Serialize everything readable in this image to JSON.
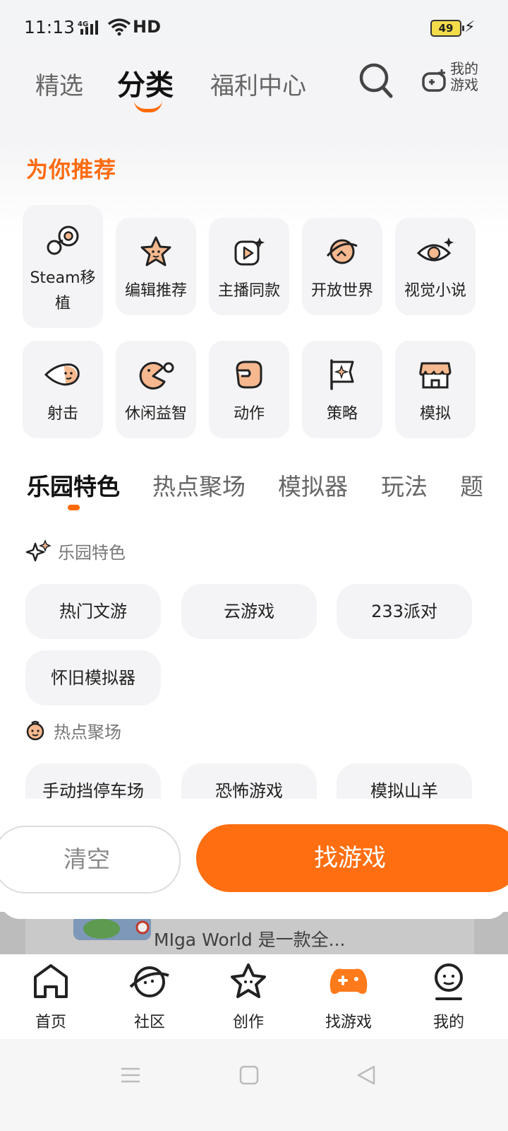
{
  "status": {
    "time": "11:13",
    "network": "4G",
    "hd": "HD",
    "battery": "49"
  },
  "top_tabs": [
    {
      "label": "精选"
    },
    {
      "label": "分类",
      "active": true
    },
    {
      "label": "福利中心"
    }
  ],
  "my_games_label": "我的游戏",
  "recommend_title": "为你推荐",
  "categories": [
    {
      "label": "Steam移植",
      "icon": "steam-icon"
    },
    {
      "label": "编辑推荐",
      "icon": "star-icon"
    },
    {
      "label": "主播同款",
      "icon": "play-icon"
    },
    {
      "label": "开放世界",
      "icon": "planet-icon"
    },
    {
      "label": "视觉小说",
      "icon": "eye-icon"
    },
    {
      "label": "射击",
      "icon": "bullet-icon"
    },
    {
      "label": "休闲益智",
      "icon": "pacman-icon"
    },
    {
      "label": "动作",
      "icon": "fist-icon"
    },
    {
      "label": "策略",
      "icon": "flag-icon"
    },
    {
      "label": "模拟",
      "icon": "shop-icon"
    }
  ],
  "sub_tabs": [
    {
      "label": "乐园特色",
      "active": true
    },
    {
      "label": "热点聚场"
    },
    {
      "label": "模拟器"
    },
    {
      "label": "玩法"
    },
    {
      "label": "题"
    }
  ],
  "groups": [
    {
      "title": "乐园特色",
      "icon": "sparkle-icon",
      "chips": [
        "热门文游",
        "云游戏",
        "233派对",
        "怀旧模拟器"
      ]
    },
    {
      "title": "热点聚场",
      "icon": "smile-icon",
      "chips": [
        "手动挡停车场",
        "恐怖游戏",
        "模拟山羊"
      ]
    }
  ],
  "behind_text": "MIga World 是一款全...",
  "buttons": {
    "clear": "清空",
    "find": "找游戏"
  },
  "bottom_nav": [
    {
      "label": "首页",
      "icon": "home-icon"
    },
    {
      "label": "社区",
      "icon": "community-icon"
    },
    {
      "label": "创作",
      "icon": "create-icon"
    },
    {
      "label": "找游戏",
      "icon": "gamepad-icon",
      "active": true
    },
    {
      "label": "我的",
      "icon": "profile-icon"
    }
  ],
  "colors": {
    "accent": "#ff6a00",
    "tile_bg": "#f4f4f6"
  }
}
